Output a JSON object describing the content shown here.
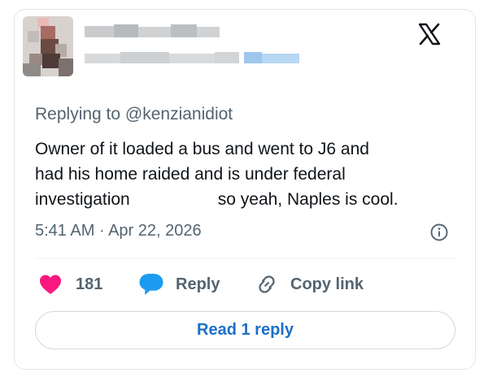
{
  "reply_context": {
    "prefix": "Replying to",
    "handle": "@kenzianidiot"
  },
  "tweet": {
    "lines": [
      "Owner of it loaded a bus and went to J6 and",
      "had his home raided and is under federal"
    ],
    "line3_start": "investigation",
    "line3_end": "so yeah, Naples is cool.",
    "time": "5:41 AM",
    "separator": "·",
    "date": "Apr 22, 2026"
  },
  "actions": {
    "like_count": "181",
    "reply_label": "Reply",
    "copy_link_label": "Copy link"
  },
  "read_replies": {
    "label": "Read 1 reply"
  },
  "icons": {
    "brand": "x-logo-icon",
    "info": "info-icon",
    "like": "heart-icon",
    "reply": "speech-bubble-icon",
    "copy": "link-icon"
  },
  "colors": {
    "heart": "#f91880",
    "reply_bubble": "#1d9bf0",
    "read_reply_text": "#1d6fc7",
    "secondary_text": "#536471",
    "primary_text": "#0f1419"
  }
}
